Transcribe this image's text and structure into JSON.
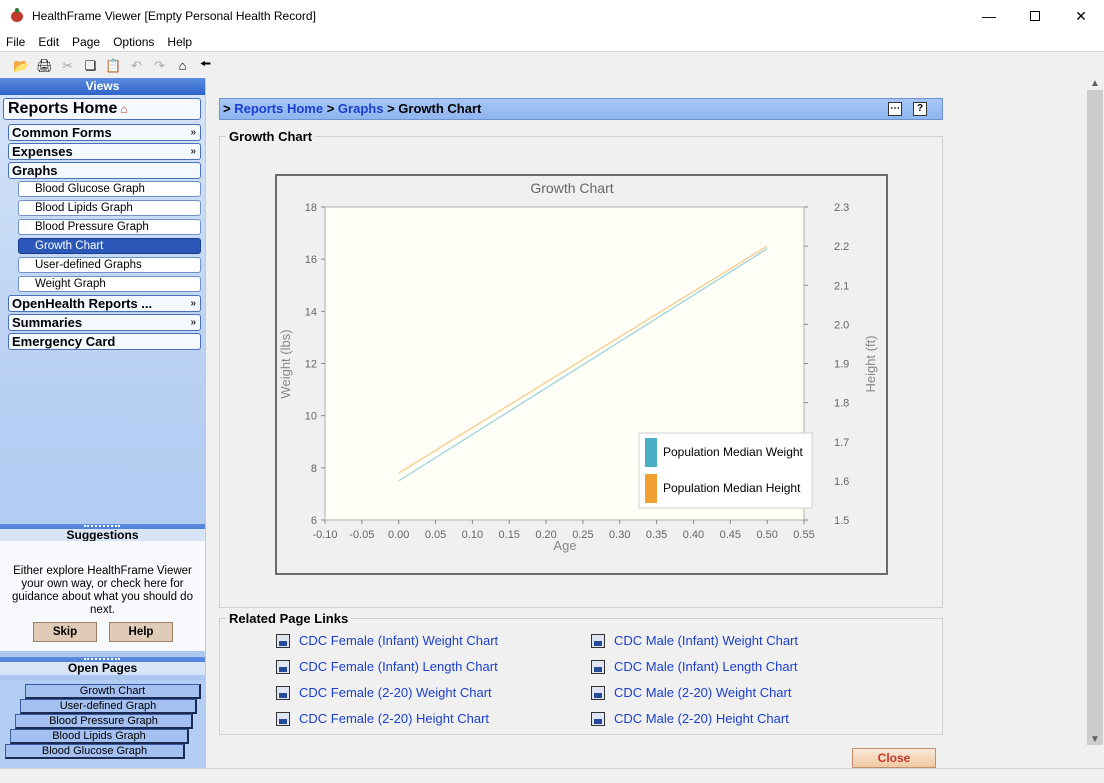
{
  "window": {
    "title": "HealthFrame Viewer [Empty Personal Health Record]"
  },
  "menu": [
    "File",
    "Edit",
    "Page",
    "Options",
    "Help"
  ],
  "sidebar": {
    "views_header": "Views",
    "reports_home": "Reports Home",
    "groups": {
      "common_forms": "Common Forms",
      "expenses": "Expenses",
      "graphs": "Graphs",
      "openhealth": "OpenHealth Reports ...",
      "summaries": "Summaries",
      "emergency": "Emergency Card"
    },
    "graph_items": [
      "Blood Glucose Graph",
      "Blood Lipids Graph",
      "Blood Pressure Graph",
      "Growth Chart",
      "User-defined Graphs",
      "Weight Graph"
    ],
    "suggestions": {
      "header": "Suggestions",
      "text": "Either explore HealthFrame Viewer your own way, or check here for guidance about what you should do next.",
      "skip": "Skip",
      "help": "Help"
    },
    "open_pages": {
      "header": "Open Pages",
      "items": [
        "Growth Chart",
        "User-defined Graph",
        "Blood Pressure Graph",
        "Blood Lipids Graph",
        "Blood Glucose Graph"
      ]
    }
  },
  "breadcrumb": {
    "prefix": ">",
    "home": "Reports Home",
    "sep": ">",
    "graphs": "Graphs",
    "current": "Growth Chart"
  },
  "panel_title": "Growth Chart",
  "related": {
    "title": "Related Page Links",
    "left": [
      "CDC Female (Infant) Weight Chart",
      "CDC Female (Infant) Length Chart",
      "CDC Female (2-20) Weight Chart",
      "CDC Female (2-20) Height Chart"
    ],
    "right": [
      "CDC Male (Infant) Weight Chart",
      "CDC Male (Infant) Length Chart",
      "CDC Male (2-20) Weight Chart",
      "CDC Male (2-20) Height Chart"
    ]
  },
  "close_label": "Close",
  "chart_data": {
    "type": "line",
    "title": "Growth Chart",
    "xlabel": "Age",
    "ylabel": "Weight (lbs)",
    "y2label": "Height (ft)",
    "xlim": [
      -0.1,
      0.55
    ],
    "ylim": [
      6,
      18
    ],
    "y2lim": [
      1.5,
      2.3
    ],
    "xticks": [
      "-0.10",
      "-0.05",
      "0.00",
      "0.05",
      "0.10",
      "0.15",
      "0.20",
      "0.25",
      "0.30",
      "0.35",
      "0.40",
      "0.45",
      "0.50",
      "0.55"
    ],
    "yticks": [
      "6",
      "8",
      "10",
      "12",
      "14",
      "16",
      "18"
    ],
    "y2ticks": [
      "1.5",
      "1.6",
      "1.7",
      "1.8",
      "1.9",
      "2.0",
      "2.1",
      "2.2",
      "2.3"
    ],
    "legend_position": "bottom-right",
    "series": [
      {
        "name": "Population Median Weight",
        "axis": "left",
        "color": "#4aaec6",
        "points": [
          [
            0,
            7.5
          ],
          [
            0.5,
            16.4
          ]
        ]
      },
      {
        "name": "Population Median Height",
        "axis": "right",
        "color": "#f0a030",
        "points": [
          [
            0,
            1.62
          ],
          [
            0.5,
            2.2
          ]
        ]
      }
    ]
  }
}
